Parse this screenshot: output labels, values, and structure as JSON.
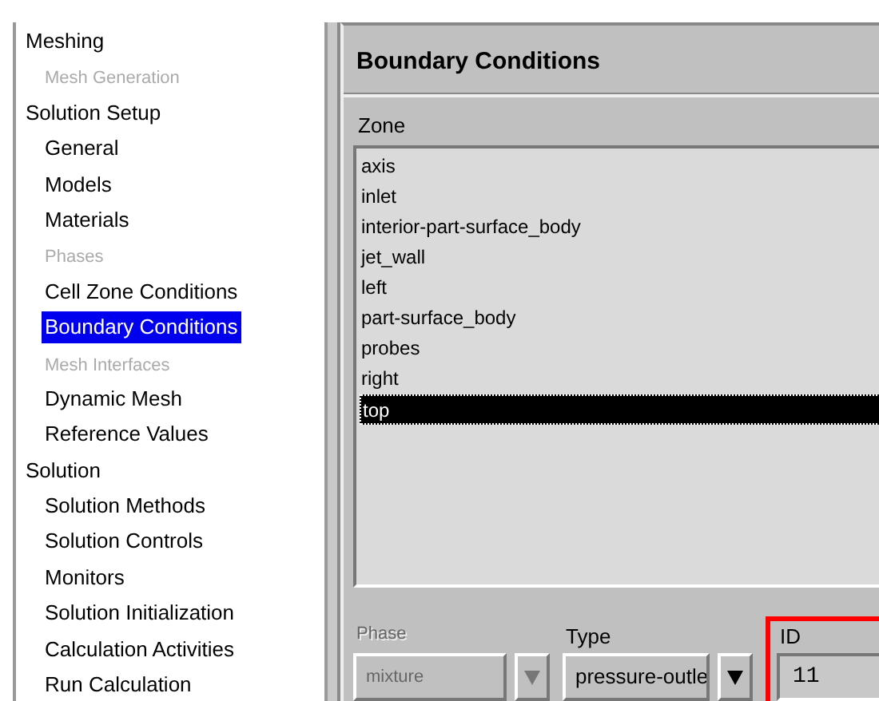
{
  "tree": [
    {
      "label": "Meshing",
      "disabled": false,
      "selected": false,
      "children": [
        {
          "label": "Mesh Generation",
          "disabled": true,
          "selected": false
        }
      ]
    },
    {
      "label": "Solution Setup",
      "disabled": false,
      "selected": false,
      "children": [
        {
          "label": "General",
          "disabled": false,
          "selected": false
        },
        {
          "label": "Models",
          "disabled": false,
          "selected": false
        },
        {
          "label": "Materials",
          "disabled": false,
          "selected": false
        },
        {
          "label": "Phases",
          "disabled": true,
          "selected": false
        },
        {
          "label": "Cell Zone Conditions",
          "disabled": false,
          "selected": false
        },
        {
          "label": "Boundary Conditions",
          "disabled": false,
          "selected": true
        },
        {
          "label": "Mesh Interfaces",
          "disabled": true,
          "selected": false
        },
        {
          "label": "Dynamic Mesh",
          "disabled": false,
          "selected": false
        },
        {
          "label": "Reference Values",
          "disabled": false,
          "selected": false
        }
      ]
    },
    {
      "label": "Solution",
      "disabled": false,
      "selected": false,
      "children": [
        {
          "label": "Solution Methods",
          "disabled": false,
          "selected": false
        },
        {
          "label": "Solution Controls",
          "disabled": false,
          "selected": false
        },
        {
          "label": "Monitors",
          "disabled": false,
          "selected": false
        },
        {
          "label": "Solution Initialization",
          "disabled": false,
          "selected": false
        },
        {
          "label": "Calculation Activities",
          "disabled": false,
          "selected": false
        },
        {
          "label": "Run Calculation",
          "disabled": false,
          "selected": false
        }
      ]
    }
  ],
  "panel": {
    "title": "Boundary Conditions",
    "zone_label": "Zone",
    "zones": [
      {
        "label": "axis",
        "selected": false
      },
      {
        "label": "inlet",
        "selected": false
      },
      {
        "label": "interior-part-surface_body",
        "selected": false
      },
      {
        "label": "jet_wall",
        "selected": false
      },
      {
        "label": "left",
        "selected": false
      },
      {
        "label": "part-surface_body",
        "selected": false
      },
      {
        "label": "probes",
        "selected": false
      },
      {
        "label": "right",
        "selected": false
      },
      {
        "label": "top",
        "selected": true
      }
    ],
    "phase": {
      "label": "Phase",
      "value": "mixture",
      "disabled": true
    },
    "type": {
      "label": "Type",
      "value": "pressure-outle",
      "disabled": false
    },
    "id": {
      "label": "ID",
      "value": "11",
      "highlighted": true
    }
  }
}
